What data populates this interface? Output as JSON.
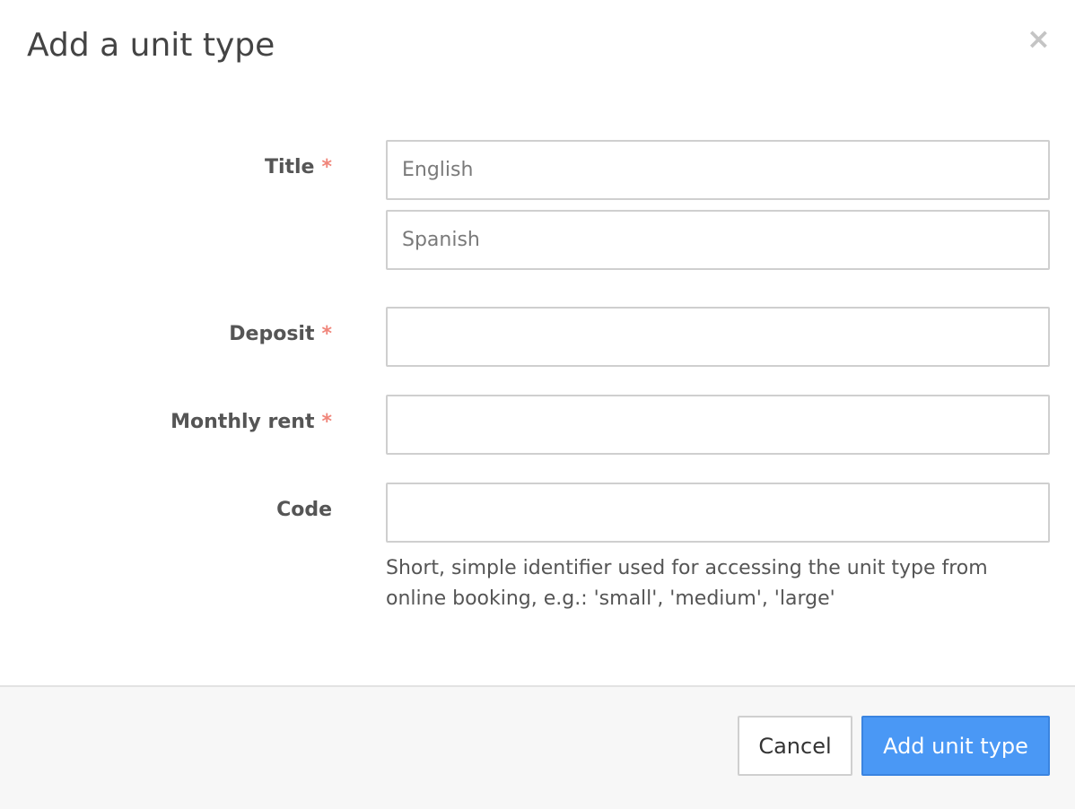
{
  "modal": {
    "title": "Add a unit type",
    "close_glyph": "×"
  },
  "form": {
    "title": {
      "label": "Title",
      "required_marker": "*",
      "english_placeholder": "English",
      "spanish_placeholder": "Spanish"
    },
    "deposit": {
      "label": "Deposit",
      "required_marker": "*",
      "value": ""
    },
    "monthly_rent": {
      "label": "Monthly rent",
      "required_marker": "*",
      "value": ""
    },
    "code": {
      "label": "Code",
      "value": "",
      "help": "Short, simple identifier used for accessing the unit type from online booking, e.g.: 'small', 'medium', 'large'"
    }
  },
  "footer": {
    "cancel_label": "Cancel",
    "submit_label": "Add unit type"
  },
  "colors": {
    "primary": "#4a98f5",
    "required": "#f0857a",
    "border": "#cfcfcf",
    "footer_bg": "#f7f7f7"
  },
  "icons": {
    "close": "close-icon"
  }
}
